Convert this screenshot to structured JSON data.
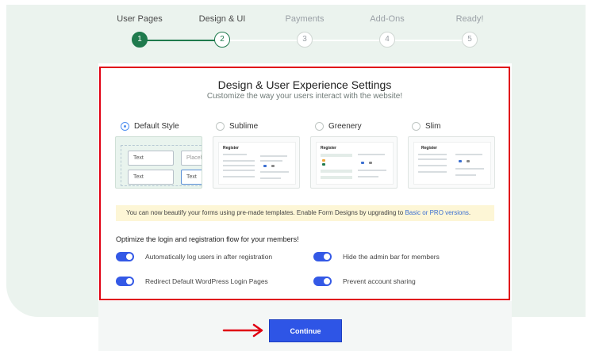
{
  "stepper": {
    "steps": [
      {
        "label": "User Pages",
        "number": "1",
        "state": "done"
      },
      {
        "label": "Design & UI",
        "number": "2",
        "state": "active"
      },
      {
        "label": "Payments",
        "number": "3",
        "state": "upcoming"
      },
      {
        "label": "Add-Ons",
        "number": "4",
        "state": "upcoming"
      },
      {
        "label": "Ready!",
        "number": "5",
        "state": "upcoming"
      }
    ]
  },
  "panel": {
    "title": "Design & User Experience Settings",
    "subtitle": "Customize the way your users interact with the website!"
  },
  "styles": [
    {
      "label": "Default Style",
      "selected": true
    },
    {
      "label": "Sublime",
      "selected": false
    },
    {
      "label": "Greenery",
      "selected": false
    },
    {
      "label": "Slim",
      "selected": false
    }
  ],
  "default_preview": {
    "field1": "Text",
    "field2": "Placeho",
    "field3": "Text",
    "field4": "Text"
  },
  "mock": {
    "register": "Register"
  },
  "notice": {
    "text": "You can now beautify your forms using pre-made templates. Enable Form Designs by upgrading to ",
    "link": "Basic or PRO versions",
    "end": "."
  },
  "options": {
    "heading": "Optimize the login and registration flow for your members!",
    "toggles": [
      {
        "label": "Automatically log users in after registration",
        "on": true
      },
      {
        "label": "Hide the admin bar for members",
        "on": true
      },
      {
        "label": "Redirect Default WordPress Login Pages",
        "on": true
      },
      {
        "label": "Prevent account sharing",
        "on": true
      }
    ]
  },
  "actions": {
    "continue": "Continue"
  },
  "colors": {
    "brand_green": "#1f7a4d",
    "toggle_blue": "#3459e6",
    "button_blue": "#2e55e6",
    "highlight_red": "#e00012",
    "annotation_arrow": "#e00012"
  }
}
